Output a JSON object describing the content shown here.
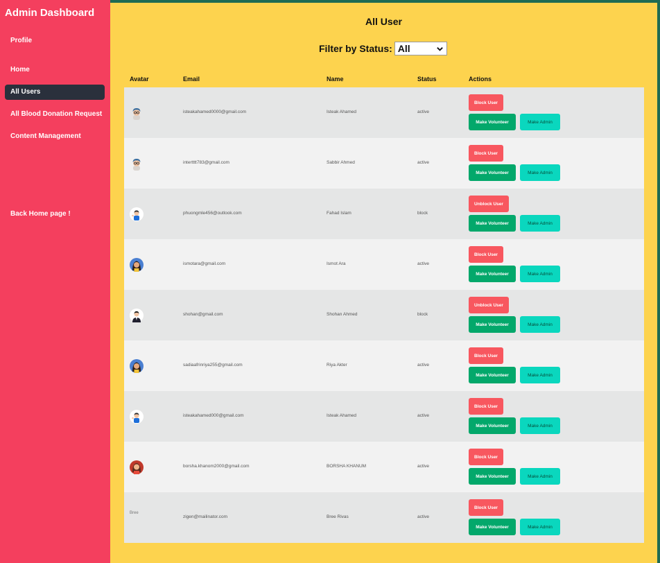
{
  "sidebar": {
    "brand": "Admin Dashboard",
    "items": [
      {
        "label": "Profile"
      },
      {
        "label": "Home"
      },
      {
        "label": "All Users",
        "active": true
      },
      {
        "label": "All Blood Donation Request"
      },
      {
        "label": "Content Management"
      },
      {
        "label": "Back Home page !"
      }
    ]
  },
  "main": {
    "title": "All User",
    "filter": {
      "label": "Filter by Status:",
      "value": "All"
    },
    "columns": [
      "Avatar",
      "Email",
      "Name",
      "Status",
      "Actions"
    ]
  },
  "colors": {
    "sidebar": "#f43f5e",
    "main_bg": "#fdd34e",
    "active_nav": "#2a303c",
    "block_button": "#f8575f",
    "volunteer_button": "#03a86b",
    "admin_button": "#0ad7be"
  },
  "users": [
    {
      "avatar": "boy-glasses-avatar",
      "email": "isteakahamed0000@gmail.com",
      "name": "Isteak Ahamed",
      "status": "active",
      "block_label": "Block User",
      "volunteer_label": "Make Volunteer",
      "admin_label": "Make Admin"
    },
    {
      "avatar": "boy-glasses-avatar",
      "email": "intertttt783@gmail.com",
      "name": "Sabbir Ahmed",
      "status": "active",
      "block_label": "Block User",
      "volunteer_label": "Make Volunteer",
      "admin_label": "Make Admin"
    },
    {
      "avatar": "boy-blue-shirt-avatar",
      "email": "phuongmle456@outlook.com",
      "name": "Fahad Islam",
      "status": "block",
      "block_label": "Unblock User",
      "volunteer_label": "Make Volunteer",
      "admin_label": "Make Admin"
    },
    {
      "avatar": "woman-avatar",
      "email": "ismotara@gmail.com",
      "name": "Ismot Ara",
      "status": "active",
      "block_label": "Block User",
      "volunteer_label": "Make Volunteer",
      "admin_label": "Make Admin"
    },
    {
      "avatar": "man-suit-avatar",
      "email": "shohan@gmail.com",
      "name": "Shohan Ahmed",
      "status": "block",
      "block_label": "Unblock User",
      "volunteer_label": "Make Volunteer",
      "admin_label": "Make Admin"
    },
    {
      "avatar": "woman-avatar",
      "email": "sadiaafrinriya255@gmail.com",
      "name": "Riya Akter",
      "status": "active",
      "block_label": "Block User",
      "volunteer_label": "Make Volunteer",
      "admin_label": "Make Admin"
    },
    {
      "avatar": "boy-blue-shirt-avatar",
      "email": "isteakahamed000@gmail.com",
      "name": "Isteak Ahamed",
      "status": "active",
      "block_label": "Block User",
      "volunteer_label": "Make Volunteer",
      "admin_label": "Make Admin"
    },
    {
      "avatar": "woman-red-avatar",
      "email": "borsha.khanom2000@gmail.com",
      "name": "BORSHA KHANUM",
      "status": "active",
      "block_label": "Block User",
      "volunteer_label": "Make Volunteer",
      "admin_label": "Make Admin"
    },
    {
      "avatar": "broken-image",
      "avatar_alt": "Bree",
      "email": "zigen@mailinator.com",
      "name": "Bree Rivas",
      "status": "active",
      "block_label": "Block User",
      "volunteer_label": "Make Volunteer",
      "admin_label": "Make Admin"
    }
  ]
}
